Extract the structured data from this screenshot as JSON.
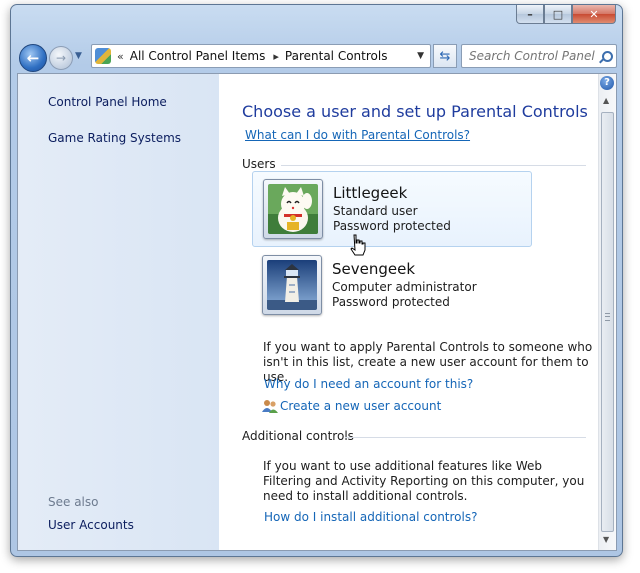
{
  "window": {
    "caption_buttons": {
      "minimize": "–",
      "maximize": "□",
      "close": "✕"
    }
  },
  "nav": {
    "back_icon": "back-arrow-icon",
    "forward_icon": "forward-arrow-icon",
    "breadcrumb_prefix": "«",
    "breadcrumb": [
      "All Control Panel Items",
      "Parental Controls"
    ],
    "breadcrumb_separator": "▸",
    "search_placeholder": "Search Control Panel"
  },
  "sidebar": {
    "items": [
      "Control Panel Home",
      "Game Rating Systems"
    ],
    "see_also_label": "See also",
    "see_also_items": [
      "User Accounts"
    ]
  },
  "main": {
    "title": "Choose a user and set up Parental Controls",
    "help_link": "What can I do with Parental Controls?",
    "users_label": "Users",
    "users": [
      {
        "name": "Littlegeek",
        "account_type": "Standard user",
        "status": "Password protected",
        "avatar": "lucky-cat-avatar-icon"
      },
      {
        "name": "Sevengeek",
        "account_type": "Computer administrator",
        "status": "Password protected",
        "avatar": "lighthouse-avatar-icon"
      }
    ],
    "new_account_text": "If you want to apply Parental Controls to someone who isn't in this list, create a new user account for them to use.",
    "why_link": "Why do I need an account for this?",
    "create_link": "Create a new user account",
    "additional_label": "Additional controls",
    "additional_text": "If you want to use additional features like Web Filtering and Activity Reporting on this computer, you need to install additional controls.",
    "install_link": "How do I install additional controls?"
  },
  "colors": {
    "title_blue": "#1f3c9e",
    "link_blue": "#1566b7",
    "sidebar_bg": "#dfe8f5"
  }
}
